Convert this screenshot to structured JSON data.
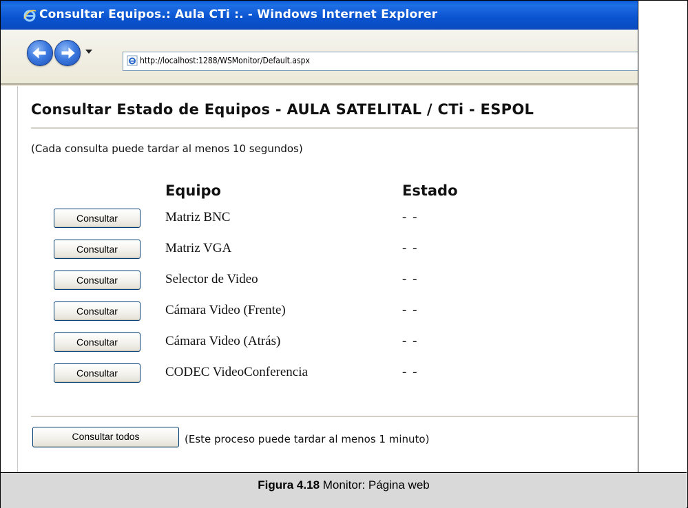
{
  "window": {
    "title": "Consultar Equipos.: Aula CTi :. - Windows Internet Explorer"
  },
  "toolbar": {
    "url": "http://localhost:1288/WSMonitor/Default.aspx"
  },
  "page": {
    "heading": "Consultar Estado de Equipos -  AULA SATELITAL / CTi - ESPOL",
    "note": "(Cada consulta puede tardar al menos 10 segundos)",
    "column_equipo": "Equipo",
    "column_estado": "Estado",
    "rows": [
      {
        "button": "Consultar",
        "equipo": "Matriz BNC",
        "estado": "- -"
      },
      {
        "button": "Consultar",
        "equipo": "Matriz VGA",
        "estado": "- -"
      },
      {
        "button": "Consultar",
        "equipo": "Selector de Video",
        "estado": "- -"
      },
      {
        "button": "Consultar",
        "equipo": "Cámara Video (Frente)",
        "estado": "- -"
      },
      {
        "button": "Consultar",
        "equipo": "Cámara Video (Atrás)",
        "estado": "- -"
      },
      {
        "button": "Consultar",
        "equipo": "CODEC VideoConferencia",
        "estado": "- -"
      }
    ],
    "all_button": "Consultar todos",
    "all_note": "(Este proceso puede tardar al menos 1 minuto)"
  },
  "caption": {
    "label": "Figura 4.18",
    "text": " Monitor: Página web"
  },
  "colors": {
    "titlebar": "#0a53cf",
    "toolbar": "#ece9d8",
    "caption_bg": "#d9d9d9",
    "button_border": "#003c74"
  },
  "icons": {
    "browser": "ie-logo-icon",
    "back": "back-arrow-icon",
    "forward": "forward-arrow-icon",
    "page": "ie-page-icon"
  }
}
